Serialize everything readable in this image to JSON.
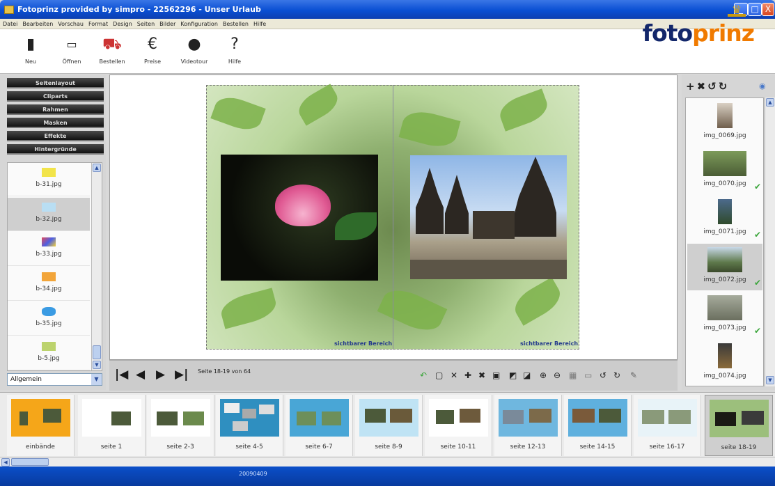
{
  "window": {
    "title": "Fotoprinz provided by simpro - 22562296 - Unser Urlaub",
    "buttons": [
      "_",
      "□",
      "X"
    ]
  },
  "menu": [
    "Datei",
    "Bearbeiten",
    "Vorschau",
    "Format",
    "Design",
    "Seiten",
    "Bilder",
    "Konfiguration",
    "Bestellen",
    "Hilfe"
  ],
  "toolbar": {
    "items": [
      {
        "label": "Neu",
        "icon": "new-icon"
      },
      {
        "label": "Öffnen",
        "icon": "open-icon"
      },
      {
        "label": "Bestellen",
        "icon": "cart-icon"
      },
      {
        "label": "Preise",
        "icon": "euro-icon"
      },
      {
        "label": "Videotour",
        "icon": "video-icon"
      },
      {
        "label": "Hilfe",
        "icon": "help-icon"
      }
    ],
    "logo": {
      "part1": "foto",
      "part2": "prinz"
    }
  },
  "left": {
    "categories": [
      "Seitenlayout",
      "Cliparts",
      "Rahmen",
      "Masken",
      "Effekte",
      "Hintergründe"
    ],
    "items": [
      {
        "label": "b-31.jpg",
        "color": "#f2e44a"
      },
      {
        "label": "b-32.jpg",
        "color": "#b9def3",
        "selected": true
      },
      {
        "label": "b-33.jpg",
        "color": "#e44b5a"
      },
      {
        "label": "b-34.jpg",
        "color": "#f2a53a"
      },
      {
        "label": "b-35.jpg",
        "color": "#3a9be3"
      },
      {
        "label": "b-5.jpg",
        "color": "#bcd36d"
      }
    ],
    "dropdown": "Allgemein"
  },
  "canvas": {
    "visible_left": "sichtbarer Bereich",
    "visible_right": "sichtbarer Bereich"
  },
  "nav": {
    "page_text": "Seite 18-19 von 64"
  },
  "right": {
    "tools": [
      "+",
      "✖",
      "↺",
      "↻"
    ],
    "items": [
      {
        "label": "img_0069.jpg",
        "check": false
      },
      {
        "label": "img_0070.jpg",
        "check": true
      },
      {
        "label": "img_0071.jpg",
        "check": true
      },
      {
        "label": "img_0072.jpg",
        "check": true,
        "selected": true
      },
      {
        "label": "img_0073.jpg",
        "check": true
      },
      {
        "label": "img_0074.jpg",
        "check": false
      }
    ]
  },
  "pages": [
    {
      "label": "einbände"
    },
    {
      "label": "seite 1"
    },
    {
      "label": "seite 2-3"
    },
    {
      "label": "seite 4-5"
    },
    {
      "label": "seite 6-7"
    },
    {
      "label": "seite 8-9"
    },
    {
      "label": "seite 10-11"
    },
    {
      "label": "seite 12-13"
    },
    {
      "label": "seite 14-15"
    },
    {
      "label": "seite 16-17"
    },
    {
      "label": "seite 18-19",
      "selected": true
    }
  ],
  "status": "20090409"
}
